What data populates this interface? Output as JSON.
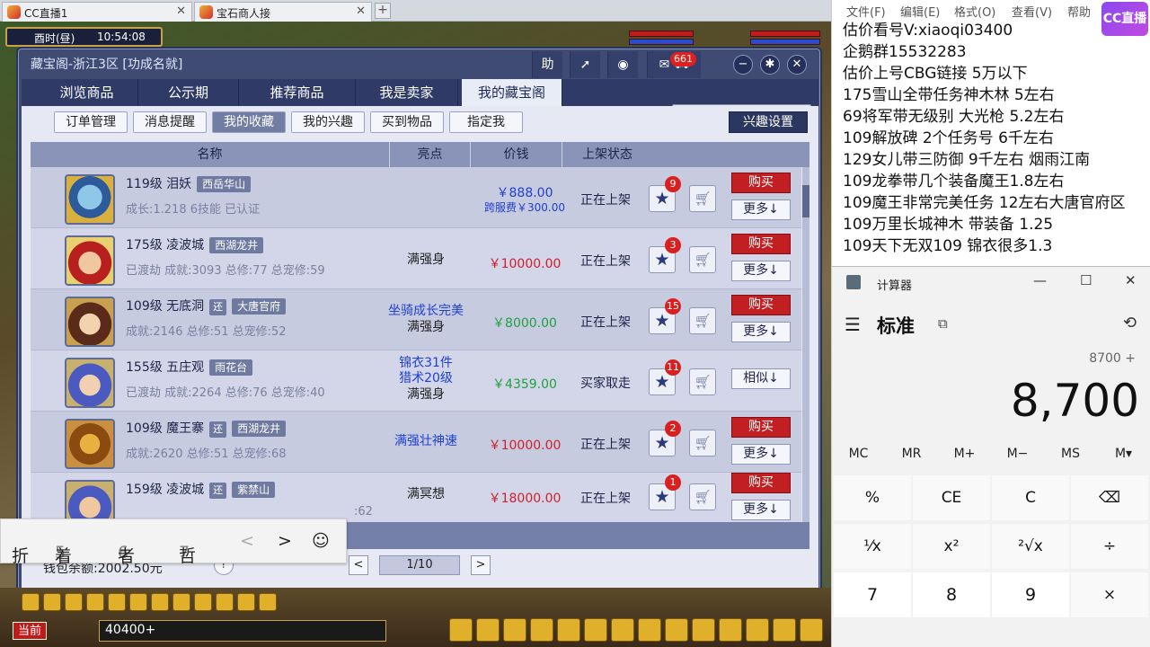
{
  "browser": {
    "tabs": [
      {
        "label": "CC直播1"
      },
      {
        "label": "宝石商人接"
      }
    ],
    "new_tab": "+"
  },
  "game": {
    "time_label": "酉时(昼)",
    "clock": "10:54:08",
    "current_label": "当前",
    "coord_text": "40400+"
  },
  "window": {
    "title": "藏宝阁-浙江3区 [功成名就]",
    "toolbar": {
      "help": "助",
      "mail_count": "661"
    },
    "nav_tabs": [
      "浏览商品",
      "公示期",
      "推荐商品",
      "我是卖家",
      "我的藏宝阁"
    ],
    "active_tab": 4,
    "sub_buttons": [
      "订单管理",
      "消息提醒",
      "我的收藏",
      "我的兴趣",
      "买到物品",
      "指定我"
    ],
    "active_sub": 2,
    "interest_settings": "兴趣设置",
    "columns": [
      "名称",
      "亮点",
      "价钱",
      "上架状态"
    ],
    "rows": [
      {
        "level_name": "119级  泪妖",
        "server": "西岳华山",
        "huan": "",
        "stats": "成长:1.218  6技能  已认证",
        "highlight": [],
        "price": "￥888.00",
        "price_color": "#2040d0",
        "cross_fee": "跨服费￥300.00",
        "status": "正在上架",
        "fav": "9",
        "action": "购买",
        "more": "更多↓"
      },
      {
        "level_name": "175级  凌波城",
        "server": "西湖龙井",
        "huan": "",
        "stats": "已渡劫  成就:3093  总修:77  总宠修:59",
        "highlight": [
          "满强身"
        ],
        "hl_colors": [
          "#222"
        ],
        "price": "￥10000.00",
        "price_color": "#d0202a",
        "cross_fee": "",
        "status": "正在上架",
        "fav": "3",
        "action": "购买",
        "more": "更多↓"
      },
      {
        "level_name": "109级  无底洞",
        "server": "大唐官府",
        "huan": "还",
        "stats": "成就:2146  总修:51  总宠修:52",
        "highlight": [
          "坐骑成长完美",
          "满强身"
        ],
        "hl_colors": [
          "#2040d0",
          "#222"
        ],
        "price": "￥8000.00",
        "price_color": "#20a040",
        "cross_fee": "",
        "status": "正在上架",
        "fav": "15",
        "action": "购买",
        "more": "更多↓"
      },
      {
        "level_name": "155级  五庄观",
        "server": "雨花台",
        "huan": "",
        "stats": "已渡劫  成就:2264  总修:76  总宠修:40",
        "highlight": [
          "锦衣31件",
          "猎术20级",
          "满强身"
        ],
        "hl_colors": [
          "#2040d0",
          "#2040d0",
          "#222"
        ],
        "price": "￥4359.00",
        "price_color": "#20a040",
        "cross_fee": "",
        "status": "买家取走",
        "fav": "11",
        "action": "",
        "more": "相似↓"
      },
      {
        "level_name": "109级  魔王寨",
        "server": "西湖龙井",
        "huan": "还",
        "stats": "成就:2620  总修:51  总宠修:68",
        "highlight": [
          "满强壮神速"
        ],
        "hl_colors": [
          "#2040d0"
        ],
        "price": "￥10000.00",
        "price_color": "#d0202a",
        "cross_fee": "",
        "status": "正在上架",
        "fav": "2",
        "action": "购买",
        "more": "更多↓"
      },
      {
        "level_name": "159级  凌波城",
        "server": "紫禁山",
        "huan": "还",
        "stats": ":62",
        "highlight": [
          "满冥想"
        ],
        "hl_colors": [
          "#222"
        ],
        "price": "￥18000.00",
        "price_color": "#d0202a",
        "cross_fee": "",
        "status": "正在上架",
        "fav": "1",
        "action": "购买",
        "more": "更多↓"
      }
    ],
    "wallet": "钱包余额:2002.50元",
    "help": "?",
    "page": "1/10",
    "prev": "<",
    "next": ">"
  },
  "ime": {
    "items": [
      {
        "num": "",
        "text": "折"
      },
      {
        "num": "5",
        "text": "着"
      },
      {
        "num": "6",
        "text": "者"
      },
      {
        "num": "7",
        "text": "哲"
      }
    ],
    "prev": "<",
    "next": ">",
    "emoji": "☺"
  },
  "notepad": {
    "menu": [
      "文件(F)",
      "编辑(E)",
      "格式(O)",
      "查看(V)",
      "帮助"
    ],
    "lines": [
      "估价看号V:xiaoqi03400",
      "企鹅群15532283",
      "估价上号CBG链接    5万以下",
      "175雪山全带任务神木林 5左右",
      "69将军带无级别 大光枪 5.2左右",
      "109解放碑 2个任务号 6千左右",
      "129女儿带三防御 9千左右 烟雨江南",
      "109龙拳带几个装备魔王1.8左右",
      "109魔王非常完美任务 12左右大唐官府区",
      "109万里长城神木 带装备  1.25",
      "109天下无双109  锦衣很多1.3"
    ]
  },
  "cc_logo": "CC直播",
  "calculator": {
    "title": "计算器",
    "mode": "标准",
    "expression": "8700 +",
    "display": "8,700",
    "memory": [
      "MC",
      "MR",
      "M+",
      "M−",
      "MS",
      "M▾"
    ],
    "keys": [
      "%",
      "CE",
      "C",
      "⌫",
      "⅟x",
      "x²",
      "²√x",
      "÷",
      "7",
      "8",
      "9",
      "×"
    ]
  }
}
